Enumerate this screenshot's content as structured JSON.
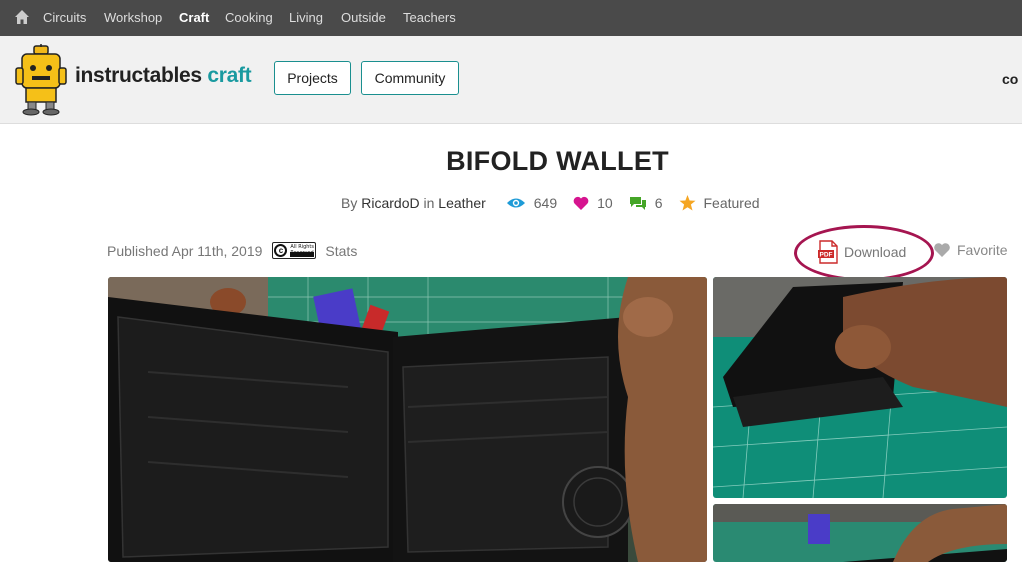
{
  "nav": {
    "items": [
      {
        "label": "Circuits",
        "active": false
      },
      {
        "label": "Workshop",
        "active": false
      },
      {
        "label": "Craft",
        "active": true
      },
      {
        "label": "Cooking",
        "active": false
      },
      {
        "label": "Living",
        "active": false
      },
      {
        "label": "Outside",
        "active": false
      },
      {
        "label": "Teachers",
        "active": false
      }
    ]
  },
  "header": {
    "logo_word": "instructables",
    "logo_channel": "craft",
    "projects_label": "Projects",
    "community_label": "Community",
    "right_cutoff": "co"
  },
  "article": {
    "title": "BIFOLD WALLET",
    "by_prefix": "By",
    "author": "RicardoD",
    "in_prefix": "in",
    "category": "Leather",
    "views": "649",
    "favorites": "10",
    "comments": "6",
    "featured": "Featured",
    "published": "Published Apr 11th, 2019",
    "license_text": "All Rights Reserved",
    "stats_label": "Stats",
    "download_label": "Download",
    "pdf_label": "PDF",
    "favorite_label": "Favorite"
  },
  "colors": {
    "nav_bg": "#4a4a4a",
    "teal": "#1a9aa0",
    "highlight": "#a51550",
    "views_icon": "#1e9bd7",
    "heart_icon": "#d6148f",
    "comment_icon": "#45a527",
    "star_icon": "#f5a623"
  }
}
